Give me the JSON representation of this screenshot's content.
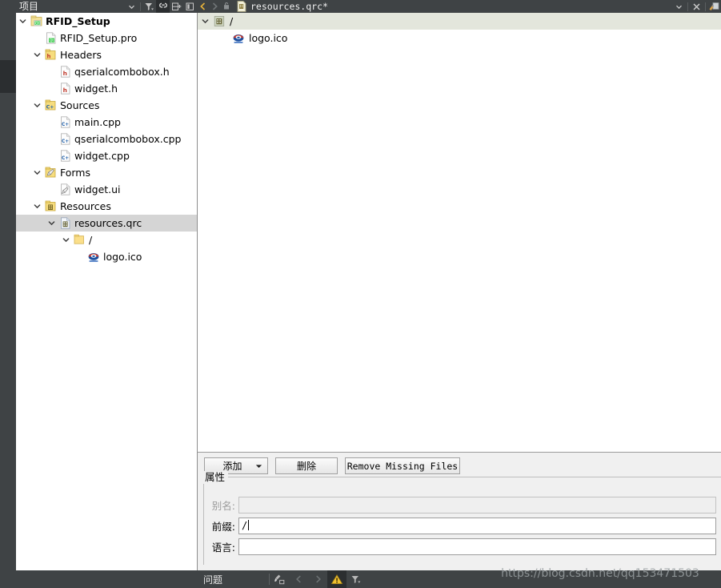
{
  "project_panel": {
    "title": "项目",
    "toolbar": [
      {
        "name": "filter-icon",
        "label": "Filter"
      },
      {
        "name": "link-icon",
        "label": "Synchronize with editor",
        "active": true
      },
      {
        "name": "split-add-icon",
        "label": "Add split"
      },
      {
        "name": "close-panel-icon",
        "label": "Close panel"
      }
    ],
    "dropdown_icon": "chevron-down-icon",
    "tree": [
      {
        "label": "RFID_Setup",
        "indent": 0,
        "arrow": "expanded",
        "icon": "qt-project-icon",
        "bold": true,
        "selected": false
      },
      {
        "label": "RFID_Setup.pro",
        "indent": 1,
        "arrow": "none",
        "icon": "pro-file-icon",
        "bold": false,
        "selected": false
      },
      {
        "label": "Headers",
        "indent": 1,
        "arrow": "expanded",
        "icon": "headers-folder-icon",
        "bold": false,
        "selected": false
      },
      {
        "label": "qserialcombobox.h",
        "indent": 2,
        "arrow": "none",
        "icon": "h-file-icon",
        "bold": false,
        "selected": false
      },
      {
        "label": "widget.h",
        "indent": 2,
        "arrow": "none",
        "icon": "h-file-icon",
        "bold": false,
        "selected": false
      },
      {
        "label": "Sources",
        "indent": 1,
        "arrow": "expanded",
        "icon": "sources-folder-icon",
        "bold": false,
        "selected": false
      },
      {
        "label": "main.cpp",
        "indent": 2,
        "arrow": "none",
        "icon": "cpp-file-icon",
        "bold": false,
        "selected": false
      },
      {
        "label": "qserialcombobox.cpp",
        "indent": 2,
        "arrow": "none",
        "icon": "cpp-file-icon",
        "bold": false,
        "selected": false
      },
      {
        "label": "widget.cpp",
        "indent": 2,
        "arrow": "none",
        "icon": "cpp-file-icon",
        "bold": false,
        "selected": false
      },
      {
        "label": "Forms",
        "indent": 1,
        "arrow": "expanded",
        "icon": "forms-folder-icon",
        "bold": false,
        "selected": false
      },
      {
        "label": "widget.ui",
        "indent": 2,
        "arrow": "none",
        "icon": "ui-file-icon",
        "bold": false,
        "selected": false
      },
      {
        "label": "Resources",
        "indent": 1,
        "arrow": "expanded",
        "icon": "resources-folder-icon",
        "bold": false,
        "selected": false
      },
      {
        "label": "resources.qrc",
        "indent": 2,
        "arrow": "expanded",
        "icon": "qrc-file-icon",
        "bold": false,
        "selected": true
      },
      {
        "label": "/",
        "indent": 3,
        "arrow": "expanded",
        "icon": "folder-icon",
        "bold": false,
        "selected": false
      },
      {
        "label": "logo.ico",
        "indent": 4,
        "arrow": "none",
        "icon": "logo-ico-icon",
        "bold": false,
        "selected": false
      }
    ]
  },
  "editor_bar": {
    "back_icon": "chevron-left-icon",
    "forward_icon": "chevron-right-icon",
    "lock_icon": "lock-icon",
    "file_icon": "qrc-file-icon",
    "filename": "resources.qrc*",
    "dropdown_icon": "chevron-down-icon",
    "close_icon": "close-icon",
    "split_icon": "split-editor-icon"
  },
  "resource_tree": {
    "rows": [
      {
        "label": "/",
        "indent": 0,
        "arrow": "expanded",
        "icon": "qrc-prefix-icon",
        "highlighted": true
      },
      {
        "label": "logo.ico",
        "indent": 1,
        "arrow": "none",
        "icon": "logo-ico-icon",
        "highlighted": false
      }
    ]
  },
  "resource_editor": {
    "buttons": {
      "add": "添加",
      "add_caret": "chevron-down-icon",
      "remove": "删除",
      "remove_missing": "Remove Missing Files"
    },
    "properties": {
      "group_title": "属性",
      "fields": [
        {
          "label": "别名:",
          "value": "",
          "disabled": true,
          "name": "alias-field"
        },
        {
          "label": "前缀:",
          "value": "/",
          "disabled": false,
          "name": "prefix-field"
        },
        {
          "label": "语言:",
          "value": "",
          "disabled": false,
          "name": "language-field"
        }
      ]
    }
  },
  "status_bar": {
    "label": "问题",
    "buttons": [
      {
        "name": "clear-icon",
        "active": false,
        "dim": false
      },
      {
        "name": "prev-issue-icon",
        "active": false,
        "dim": true
      },
      {
        "name": "next-issue-icon",
        "active": false,
        "dim": true
      },
      {
        "name": "warning-icon",
        "active": true,
        "dim": false
      },
      {
        "name": "filter-icon",
        "active": false,
        "dim": false
      }
    ]
  },
  "watermark": {
    "text": "https://blog.csdn.net/qq153471503"
  },
  "colors": {
    "chrome": "#3f4345",
    "chrome_dark": "#2b2e30",
    "panel_bg": "#f0f0f0",
    "selection": "#d5d5d5",
    "highlight_row": "#e3e6dc",
    "accent_yellow": "#e8b33a"
  }
}
